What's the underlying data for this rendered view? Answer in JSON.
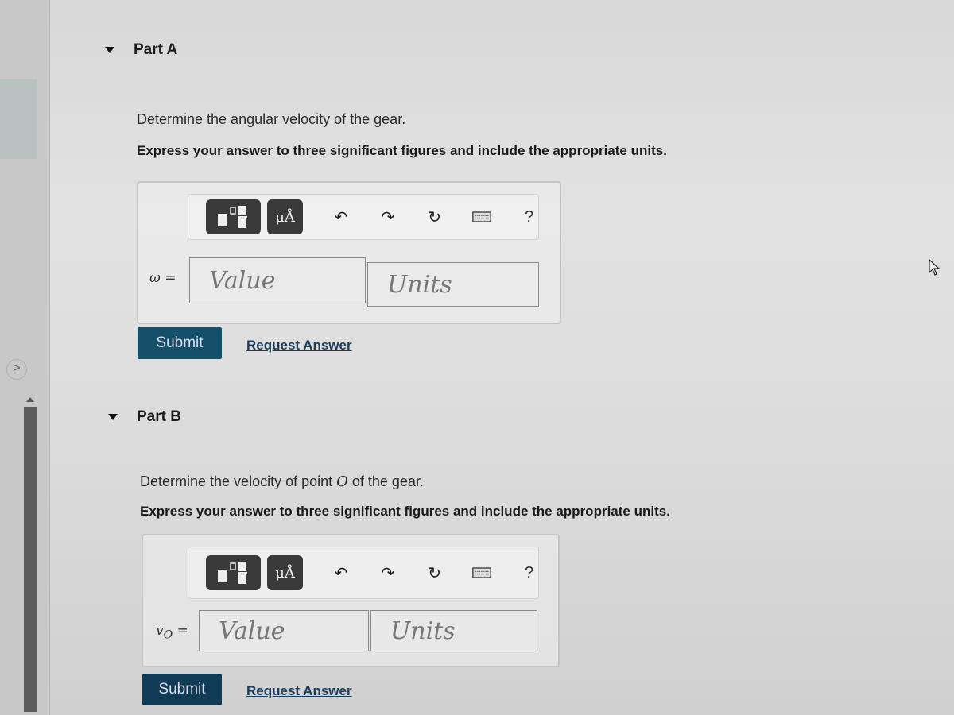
{
  "parts": [
    {
      "title": "Part A",
      "question": "Determine the angular velocity of the gear.",
      "instruction": "Express your answer to three significant figures and include the appropriate units.",
      "variable_label": "ω =",
      "value_placeholder": "Value",
      "units_placeholder": "Units",
      "submit_label": "Submit",
      "request_answer_label": "Request Answer"
    },
    {
      "title": "Part B",
      "question_prefix": "Determine the velocity of point ",
      "question_symbol": "O",
      "question_suffix": " of the gear.",
      "instruction": "Express your answer to three significant figures and include the appropriate units.",
      "variable_label": "v",
      "variable_subscript": "O",
      "variable_eq": " =",
      "value_placeholder": "Value",
      "units_placeholder": "Units",
      "submit_label": "Submit",
      "request_answer_label": "Request Answer"
    }
  ],
  "toolbar": {
    "units_button_label": "μÅ",
    "help_label": "?",
    "icons": [
      "templates-icon",
      "units-icon",
      "undo-icon",
      "redo-icon",
      "reset-icon",
      "keyboard-icon",
      "help-icon"
    ]
  },
  "sidebar": {
    "expand_glyph": ">"
  },
  "colors": {
    "submit_bg": "#14506a",
    "link": "#1d3d5e",
    "toolbar_button": "#3a3a3a"
  }
}
